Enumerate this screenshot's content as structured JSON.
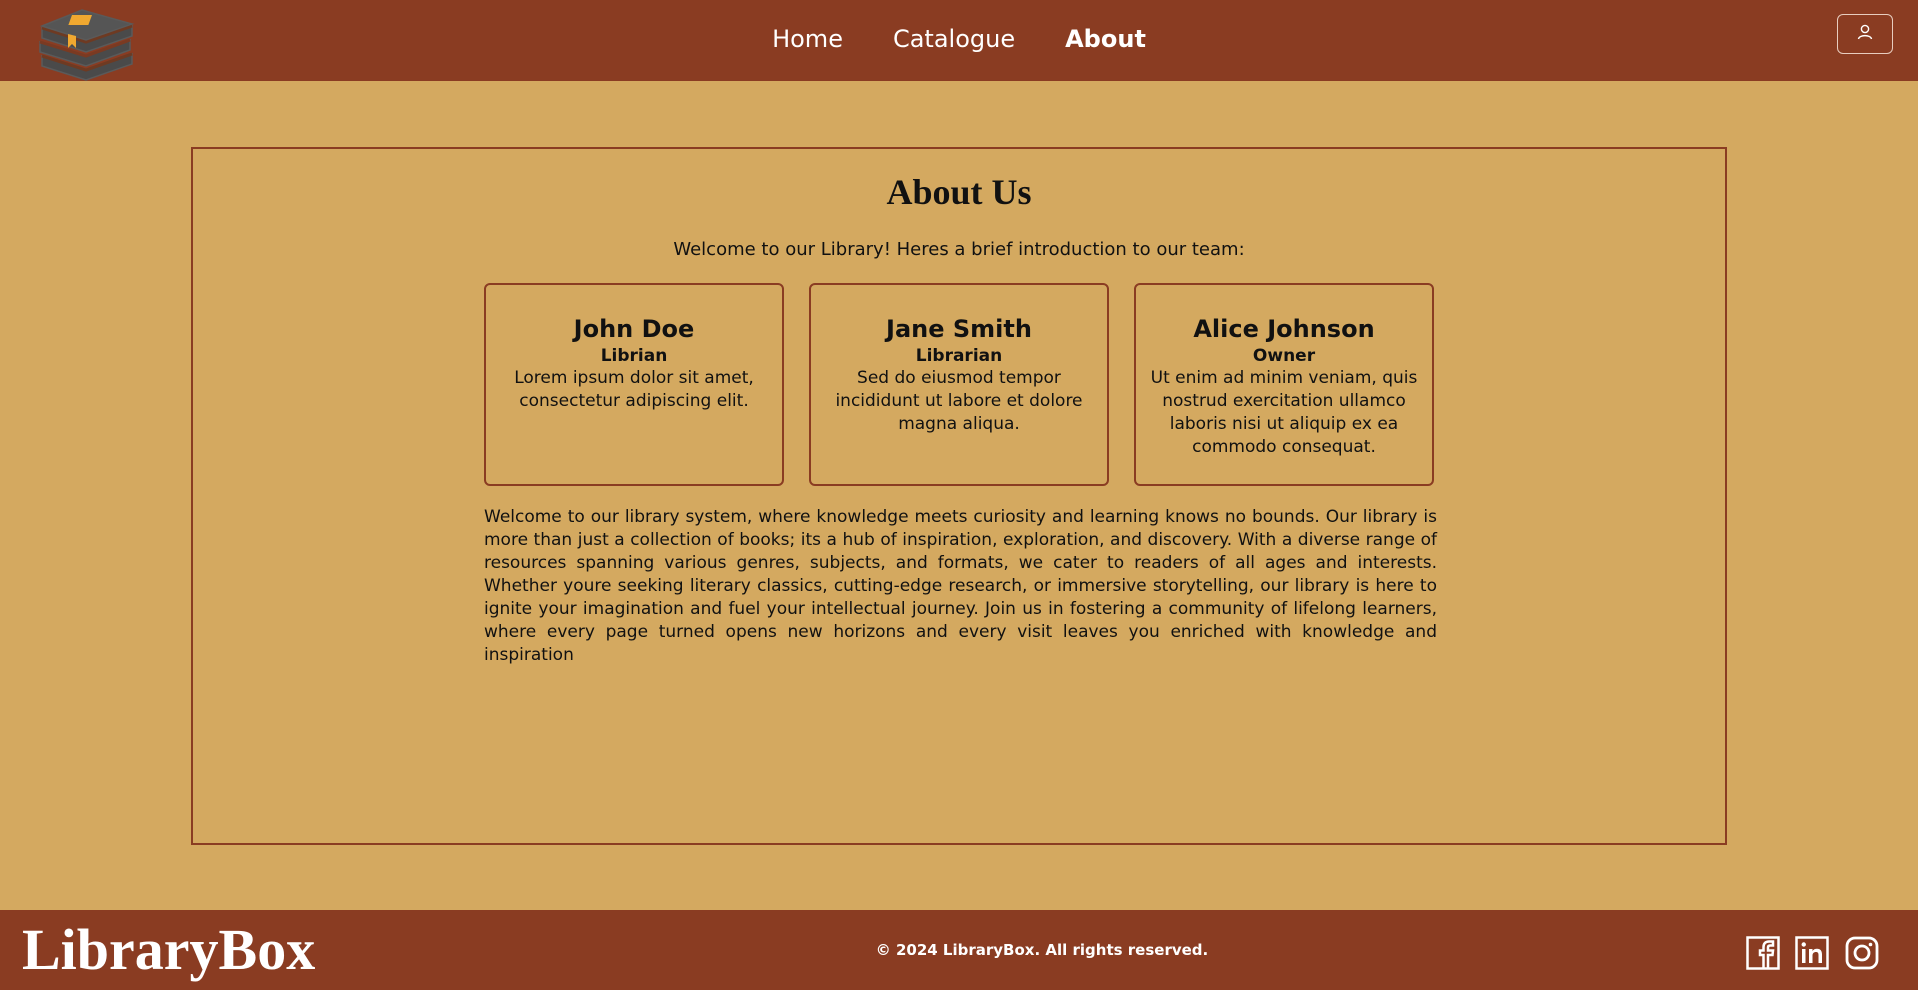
{
  "header": {
    "logo_icon": "book-stack-icon",
    "nav": [
      {
        "label": "Home",
        "active": false
      },
      {
        "label": "Catalogue",
        "active": false
      },
      {
        "label": "About",
        "active": true
      }
    ],
    "user_icon": "user-icon"
  },
  "main": {
    "title": "About Us",
    "intro": "Welcome to our Library! Heres a brief introduction to our team:",
    "team": [
      {
        "name": "John Doe",
        "role": "Librian",
        "desc": "Lorem ipsum dolor sit amet, consectetur adipiscing elit."
      },
      {
        "name": "Jane Smith",
        "role": "Librarian",
        "desc": "Sed do eiusmod tempor incididunt ut labore et dolore magna aliqua."
      },
      {
        "name": "Alice Johnson",
        "role": "Owner",
        "desc": "Ut enim ad minim veniam, quis nostrud exercitation ullamco laboris nisi ut aliquip ex ea commodo consequat."
      }
    ],
    "body": "Welcome to our library system, where knowledge meets curiosity and learning knows no bounds. Our library is more than just a collection of books; its a hub of inspiration, exploration, and discovery. With a diverse range of resources spanning various genres, subjects, and formats, we cater to readers of all ages and interests. Whether youre seeking literary classics, cutting-edge research, or immersive storytelling, our library is here to ignite your imagination and fuel your intellectual journey. Join us in fostering a community of lifelong learners, where every page turned opens new horizons and every visit leaves you enriched with knowledge and inspiration"
  },
  "footer": {
    "brand": "LibraryBox",
    "copyright": "© 2024 LibraryBox. All rights reserved.",
    "social": [
      "facebook-icon",
      "linkedin-icon",
      "instagram-icon"
    ]
  },
  "colors": {
    "header_bg": "#8a3c22",
    "page_bg": "#d4a960",
    "border": "#8a3c22"
  }
}
